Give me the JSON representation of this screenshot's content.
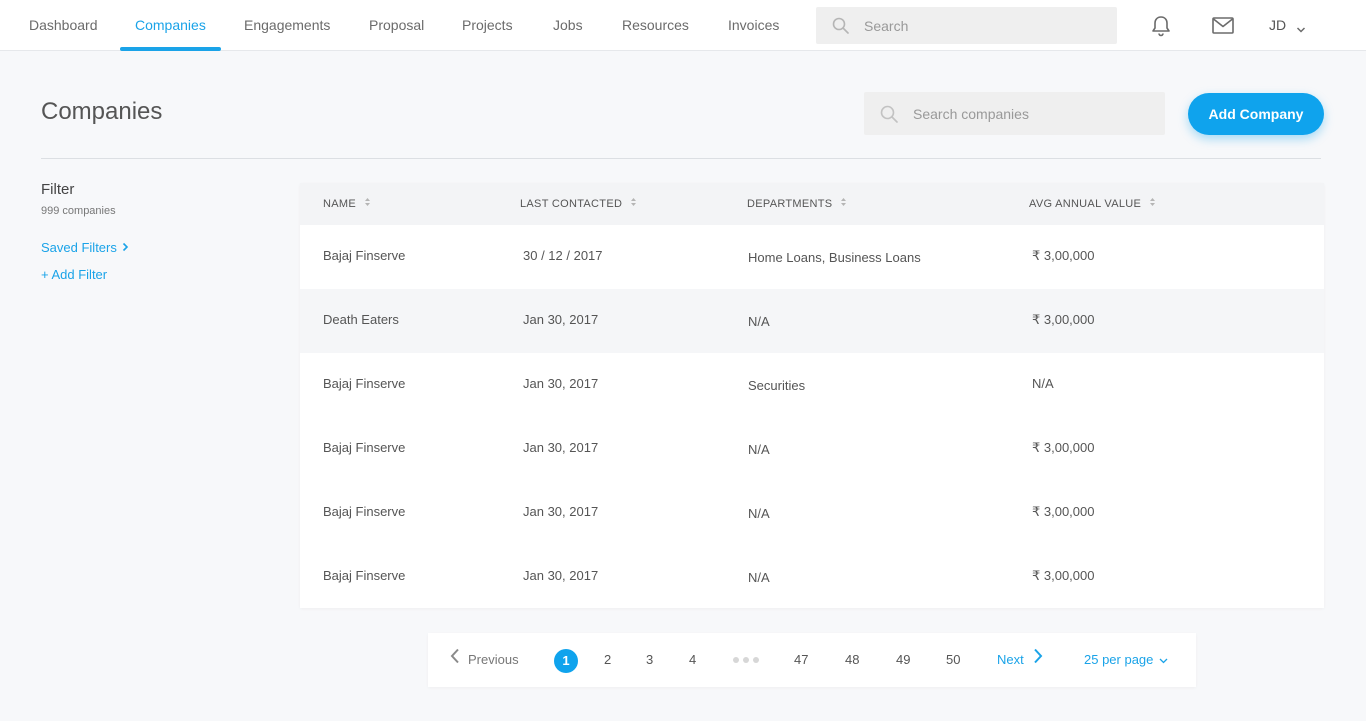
{
  "nav": {
    "items": [
      {
        "label": "Dashboard"
      },
      {
        "label": "Companies"
      },
      {
        "label": "Engagements"
      },
      {
        "label": "Proposal"
      },
      {
        "label": "Projects"
      },
      {
        "label": "Jobs"
      },
      {
        "label": "Resources"
      },
      {
        "label": "Invoices"
      }
    ],
    "active": "Companies",
    "search_placeholder": "Search",
    "user_initials": "JD"
  },
  "page": {
    "title": "Companies",
    "search_placeholder": "Search companies",
    "add_button": "Add Company"
  },
  "filter": {
    "title": "Filter",
    "count": "999 companies",
    "saved_filters": "Saved Filters",
    "add_filter": "+ Add Filter"
  },
  "table": {
    "columns": [
      "NAME",
      "LAST CONTACTED",
      "DEPARTMENTS",
      "AVG ANNUAL VALUE"
    ],
    "rows": [
      {
        "name": "Bajaj Finserve",
        "last_contacted": "30 / 12 / 2017",
        "departments": "Home Loans, Business Loans",
        "avg_value": "₹ 3,00,000"
      },
      {
        "name": "Death Eaters",
        "last_contacted": "Jan 30, 2017",
        "departments": "N/A",
        "avg_value": "₹ 3,00,000"
      },
      {
        "name": "Bajaj Finserve",
        "last_contacted": "Jan 30, 2017",
        "departments": "Securities",
        "avg_value": "N/A"
      },
      {
        "name": "Bajaj Finserve",
        "last_contacted": "Jan 30, 2017",
        "departments": "N/A",
        "avg_value": "₹ 3,00,000"
      },
      {
        "name": "Bajaj Finserve",
        "last_contacted": "Jan 30, 2017",
        "departments": "N/A",
        "avg_value": "₹ 3,00,000"
      },
      {
        "name": "Bajaj Finserve",
        "last_contacted": "Jan 30, 2017",
        "departments": "N/A",
        "avg_value": "₹ 3,00,000"
      }
    ]
  },
  "pagination": {
    "previous": "Previous",
    "next": "Next",
    "current": "1",
    "pages": [
      "2",
      "3",
      "4",
      "47",
      "48",
      "49",
      "50"
    ],
    "per_page": "25 per page"
  },
  "colors": {
    "accent": "#1aa3e8",
    "button": "#0fa3ed"
  }
}
